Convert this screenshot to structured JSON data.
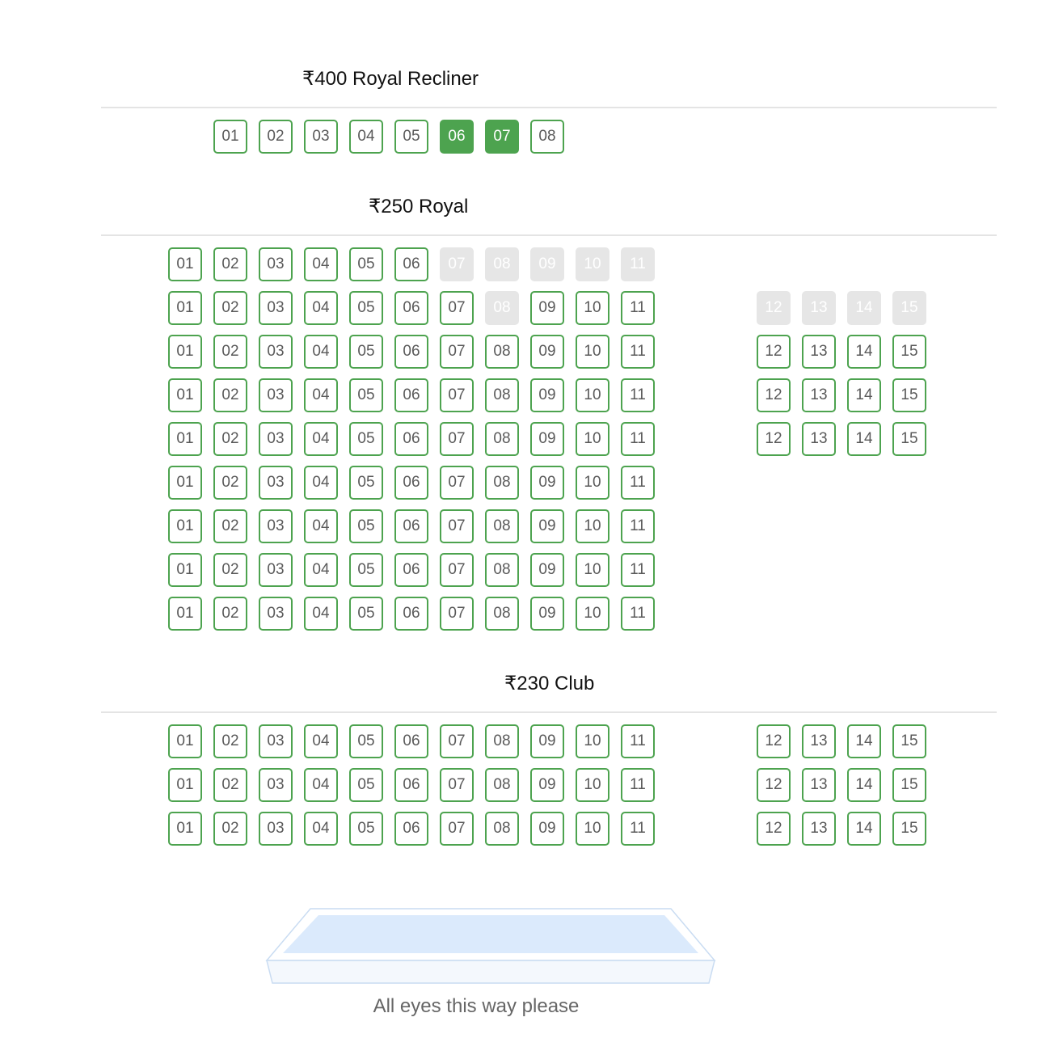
{
  "sections": [
    {
      "id": "royal-recliner",
      "title": "₹400 Royal Recliner",
      "rows": [
        {
          "seats": [
            {
              "label": "01",
              "status": "available"
            },
            {
              "label": "02",
              "status": "available"
            },
            {
              "label": "03",
              "status": "available"
            },
            {
              "label": "04",
              "status": "available"
            },
            {
              "label": "05",
              "status": "available"
            },
            {
              "label": "06",
              "status": "selected"
            },
            {
              "label": "07",
              "status": "selected"
            },
            {
              "label": "08",
              "status": "available"
            }
          ]
        }
      ]
    },
    {
      "id": "royal",
      "title": "₹250 Royal",
      "rows": [
        {
          "seats": [
            {
              "label": "01",
              "status": "available"
            },
            {
              "label": "02",
              "status": "available"
            },
            {
              "label": "03",
              "status": "available"
            },
            {
              "label": "04",
              "status": "available"
            },
            {
              "label": "05",
              "status": "available"
            },
            {
              "label": "06",
              "status": "available"
            },
            {
              "label": "07",
              "status": "sold"
            },
            {
              "label": "08",
              "status": "sold"
            },
            {
              "label": "09",
              "status": "sold"
            },
            {
              "label": "10",
              "status": "sold"
            },
            {
              "label": "11",
              "status": "sold"
            }
          ]
        },
        {
          "seats": [
            {
              "label": "01",
              "status": "available"
            },
            {
              "label": "02",
              "status": "available"
            },
            {
              "label": "03",
              "status": "available"
            },
            {
              "label": "04",
              "status": "available"
            },
            {
              "label": "05",
              "status": "available"
            },
            {
              "label": "06",
              "status": "available"
            },
            {
              "label": "07",
              "status": "available"
            },
            {
              "label": "08",
              "status": "sold"
            },
            {
              "label": "09",
              "status": "available"
            },
            {
              "label": "10",
              "status": "available"
            },
            {
              "label": "11",
              "status": "available"
            },
            {
              "label": "12",
              "status": "sold"
            },
            {
              "label": "13",
              "status": "sold"
            },
            {
              "label": "14",
              "status": "sold"
            },
            {
              "label": "15",
              "status": "sold"
            }
          ]
        },
        {
          "preset": "full"
        },
        {
          "preset": "full"
        },
        {
          "preset": "full"
        },
        {
          "preset": "left"
        },
        {
          "preset": "left"
        },
        {
          "preset": "left"
        },
        {
          "preset": "left"
        }
      ]
    },
    {
      "id": "club",
      "title": "₹230 Club",
      "rows": [
        {
          "preset": "full"
        },
        {
          "preset": "full"
        },
        {
          "preset": "full"
        }
      ]
    }
  ],
  "screen": {
    "caption": "All eyes this way please"
  },
  "colors": {
    "available_border": "#4da34f",
    "selected_fill": "#4da34f",
    "sold_fill": "#e6e6e6",
    "text": "#5a5a5a"
  }
}
